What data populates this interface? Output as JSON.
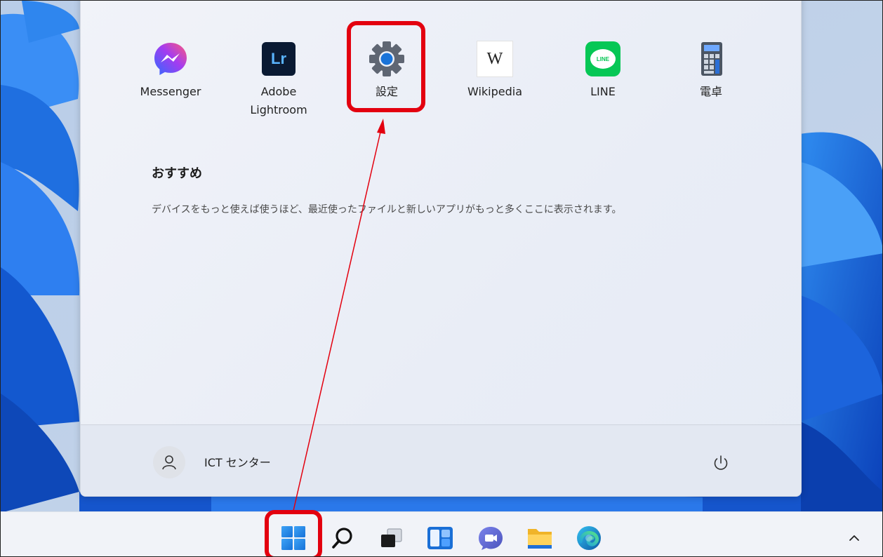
{
  "pinned_apps": [
    {
      "name": "messenger",
      "label": "Messenger",
      "icon": "messenger-icon"
    },
    {
      "name": "adobe-lightroom",
      "label_line1": "Adobe",
      "label_line2": "Lightroom",
      "icon": "lightroom-icon",
      "icon_text": "Lr"
    },
    {
      "name": "settings",
      "label": "設定",
      "icon": "gear-icon"
    },
    {
      "name": "wikipedia",
      "label": "Wikipedia",
      "icon": "wikipedia-icon",
      "icon_text": "W"
    },
    {
      "name": "line",
      "label": "LINE",
      "icon": "line-icon",
      "icon_text": "LINE"
    },
    {
      "name": "calculator",
      "label": "電卓",
      "icon": "calculator-icon"
    }
  ],
  "recommended": {
    "title": "おすすめ",
    "empty_text": "デバイスをもっと使えば使うほど、最近使ったファイルと新しいアプリがもっと多くここに表示されます。"
  },
  "user": {
    "name": "ICT センター",
    "icon": "user-icon"
  },
  "power": {
    "icon": "power-icon"
  },
  "taskbar": {
    "items": [
      "start-icon",
      "search-icon",
      "task-view-icon",
      "widgets-icon",
      "chat-icon",
      "file-explorer-icon",
      "edge-icon"
    ],
    "tray": "chevron-up-icon"
  },
  "colors": {
    "highlight": "#e3000f",
    "accent": "#1a73d8"
  }
}
